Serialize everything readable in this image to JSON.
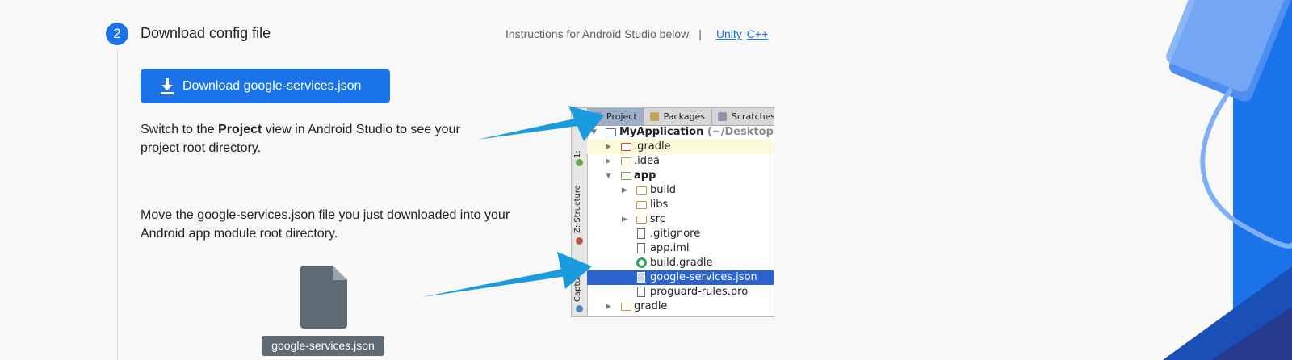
{
  "step": {
    "number": "2",
    "title": "Download config file",
    "instructions_text": "Instructions for Android Studio below",
    "separator": "|",
    "links": [
      "Unity",
      "C++"
    ]
  },
  "download_button": {
    "label": "Download google-services.json",
    "icon": "download-icon"
  },
  "paragraph1": {
    "before": "Switch to the ",
    "bold": "Project",
    "after": " view in Android Studio to see your project root directory."
  },
  "paragraph2": "Move the google-services.json file you just downloaded into your Android app module root directory.",
  "file_label": "google-services.json",
  "studio": {
    "tabs": [
      "Project",
      "Packages",
      "Scratches"
    ],
    "side_labels": [
      "1:",
      "Z: Structure",
      "Captures"
    ],
    "tree": [
      {
        "label": "MyApplication",
        "suffix": " (~/Desktop/My",
        "bold": true,
        "icon": "module-folder"
      },
      {
        "label": ".gradle",
        "icon": "folder-red"
      },
      {
        "label": ".idea",
        "icon": "folder"
      },
      {
        "label": "app",
        "bold": true,
        "icon": "module-folder"
      },
      {
        "label": "build",
        "icon": "folder"
      },
      {
        "label": "libs",
        "icon": "folder"
      },
      {
        "label": "src",
        "icon": "folder"
      },
      {
        "label": ".gitignore",
        "icon": "file"
      },
      {
        "label": "app.iml",
        "icon": "file"
      },
      {
        "label": "build.gradle",
        "icon": "gradle"
      },
      {
        "label": "google-services.json",
        "icon": "json",
        "selected": true
      },
      {
        "label": "proguard-rules.pro",
        "icon": "file"
      },
      {
        "label": "gradle",
        "icon": "folder"
      }
    ]
  },
  "colors": {
    "accent": "#1a73e8",
    "arrow": "#1a9be0",
    "selection": "#2d63cf"
  }
}
